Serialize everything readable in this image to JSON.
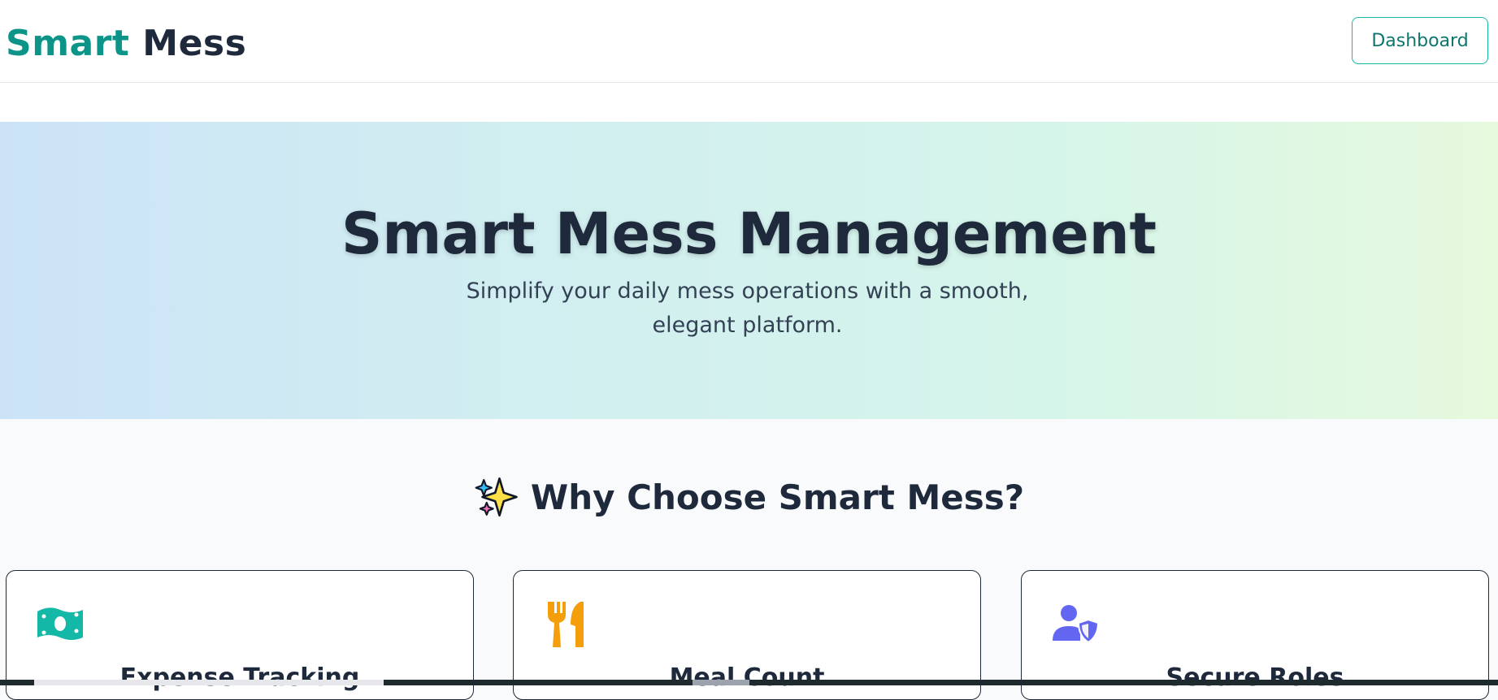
{
  "navbar": {
    "logo_part1": "Smart",
    "logo_part2": "Mess",
    "dashboard_label": "Dashboard"
  },
  "hero": {
    "title": "Smart Mess Management",
    "subtitle": "Simplify your daily mess operations with a smooth, elegant platform."
  },
  "features": {
    "heading": "Why Choose Smart Mess?",
    "heading_icon": "sparkles-icon",
    "cards": [
      {
        "title": "Expense Tracking",
        "icon": "money-bill-icon",
        "icon_color": "#14b8a6"
      },
      {
        "title": "Meal Count",
        "icon": "utensils-icon",
        "icon_color": "#f59e0b"
      },
      {
        "title": "Secure Roles",
        "icon": "user-shield-icon",
        "icon_color": "#6366f1"
      }
    ]
  },
  "colors": {
    "brand": "#0d9488",
    "text_dark": "#1e293b",
    "hero_gradient_start": "#cce3f7",
    "hero_gradient_end": "#e6f9dd"
  }
}
